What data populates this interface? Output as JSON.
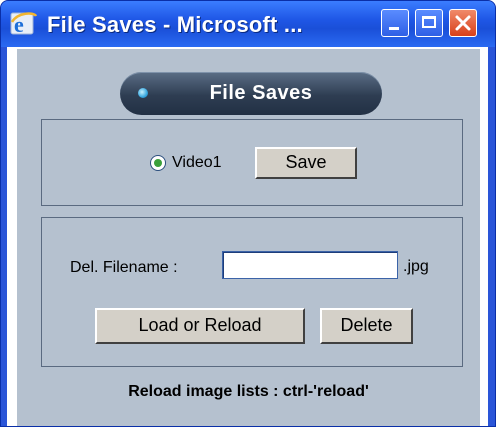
{
  "window": {
    "title": "File Saves - Microsoft ...",
    "icon": "internet-explorer-icon",
    "controls": [
      "minimize-icon",
      "maximize-icon",
      "close-icon"
    ]
  },
  "header": {
    "label": "File Saves"
  },
  "save_section": {
    "radio_label": "Video1",
    "radio_selected": true,
    "save_label": "Save"
  },
  "delete_section": {
    "label": "Del. Filename :",
    "input_value": "",
    "extension": ".jpg",
    "load_label": "Load or Reload",
    "delete_label": "Delete"
  },
  "footer": {
    "text": "Reload image lists : ctrl-'reload'"
  },
  "colors": {
    "titlebar": "#1f57e6",
    "panel": "#b5c1cf",
    "header_pill": "#2e3d52",
    "button_face": "#d4d0c8"
  }
}
